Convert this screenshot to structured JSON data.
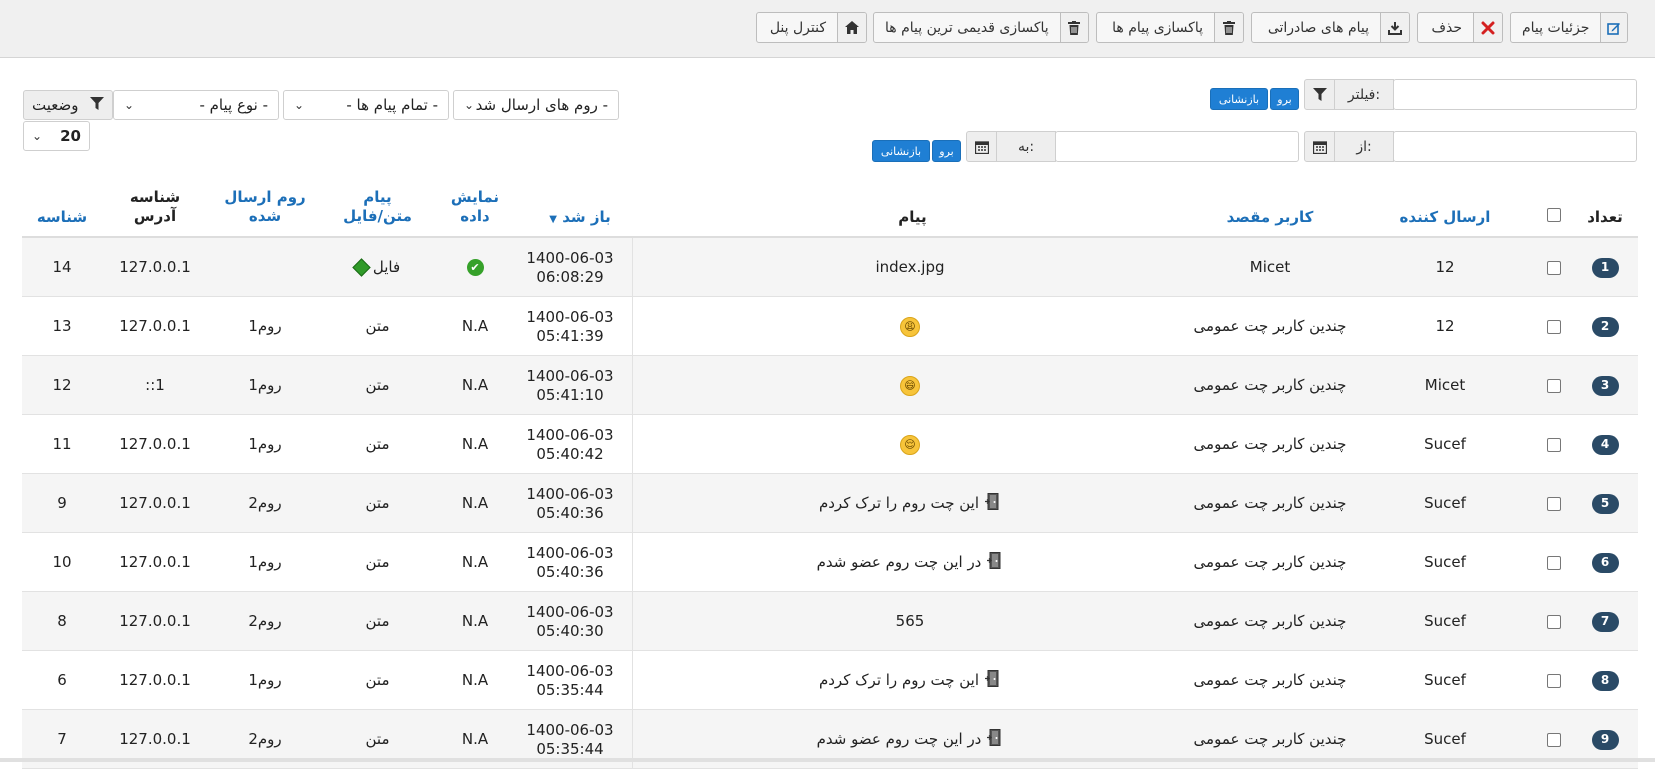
{
  "toolbar": {
    "details": "جزئیات پیام",
    "delete": "حذف",
    "export": "پیام های صادراتی",
    "purge": "پاکسازی پیام ها",
    "purge_oldest": "پاکسازی قدیمی ترین پیام ها",
    "control_panel": "کنترل پنل"
  },
  "filters": {
    "filter_label": "فیلتر:",
    "go": "برو",
    "reset": "بازنشانی",
    "from_label": "از:",
    "to_label": "به:",
    "go2": "برو",
    "reset2": "بازنشانی",
    "rooms_select": "- روم های ارسال شد",
    "messages_select": "- تمام پیام ها -",
    "type_select": "- نوع پیام -",
    "status_label": "وضعیت",
    "page_size": "20"
  },
  "table": {
    "headers": {
      "count": "تعداد",
      "sender": "ارسال کننده",
      "target": "کاربر مقصد",
      "message": "پیام",
      "seen": "باز شد",
      "shown_l1": "نمایش",
      "shown_l2": "داده",
      "msg_type_l1": "پیام",
      "msg_type_l2": "متن/فایل",
      "room_l1": "روم ارسال",
      "room_l2": "شده",
      "addr_l1": "شناسه",
      "addr_l2": "آدرس",
      "id": "شناسه"
    },
    "rows": [
      {
        "n": "1",
        "sender": "12",
        "target": "Micet",
        "message": "index.jpg",
        "icon": "none",
        "date": "1400-06-03",
        "time": "06:08:29",
        "shown": "",
        "shown_icon": "check-icon",
        "type": "فایل",
        "type_icon": "file-icon",
        "room": "",
        "ip": "127.0.0.1",
        "id": "14"
      },
      {
        "n": "2",
        "sender": "12",
        "target": "چندین کاربر چت عمومی",
        "message": "",
        "icon": "tired-emoji",
        "emoji": "😩",
        "date": "1400-06-03",
        "time": "05:41:39",
        "shown": "N.A",
        "type": "متن",
        "room": "روم1",
        "ip": "127.0.0.1",
        "id": "13"
      },
      {
        "n": "3",
        "sender": "Micet",
        "target": "چندین کاربر چت عمومی",
        "message": "",
        "icon": "grin-emoji",
        "emoji": "😄",
        "date": "1400-06-03",
        "time": "05:41:10",
        "shown": "N.A",
        "type": "متن",
        "room": "روم1",
        "ip": "::1",
        "id": "12"
      },
      {
        "n": "4",
        "sender": "Sucef",
        "target": "چندین کاربر چت عمومی",
        "message": "",
        "icon": "relieved-emoji",
        "emoji": "😌",
        "date": "1400-06-03",
        "time": "05:40:42",
        "shown": "N.A",
        "type": "متن",
        "room": "روم1",
        "ip": "127.0.0.1",
        "id": "11"
      },
      {
        "n": "5",
        "sender": "Sucef",
        "target": "چندین کاربر چت عمومی",
        "message": "این چت روم را ترک کردم",
        "icon": "door-icon",
        "date": "1400-06-03",
        "time": "05:40:36",
        "shown": "N.A",
        "type": "متن",
        "room": "روم2",
        "ip": "127.0.0.1",
        "id": "9"
      },
      {
        "n": "6",
        "sender": "Sucef",
        "target": "چندین کاربر چت عمومی",
        "message": "در این چت روم عضو شدم",
        "icon": "door-icon",
        "date": "1400-06-03",
        "time": "05:40:36",
        "shown": "N.A",
        "type": "متن",
        "room": "روم1",
        "ip": "127.0.0.1",
        "id": "10"
      },
      {
        "n": "7",
        "sender": "Sucef",
        "target": "چندین کاربر چت عمومی",
        "message": "565",
        "icon": "none",
        "date": "1400-06-03",
        "time": "05:40:30",
        "shown": "N.A",
        "type": "متن",
        "room": "روم2",
        "ip": "127.0.0.1",
        "id": "8"
      },
      {
        "n": "8",
        "sender": "Sucef",
        "target": "چندین کاربر چت عمومی",
        "message": "این چت روم را ترک کردم",
        "icon": "door-icon",
        "date": "1400-06-03",
        "time": "05:35:44",
        "shown": "N.A",
        "type": "متن",
        "room": "روم1",
        "ip": "127.0.0.1",
        "id": "6"
      },
      {
        "n": "9",
        "sender": "Sucef",
        "target": "چندین کاربر چت عمومی",
        "message": "در این چت روم عضو شدم",
        "icon": "door-icon",
        "date": "1400-06-03",
        "time": "05:35:44",
        "shown": "N.A",
        "type": "متن",
        "room": "روم2",
        "ip": "127.0.0.1",
        "id": "7"
      }
    ]
  },
  "colors": {
    "link": "#1c6fb8",
    "badge": "#2a4a66",
    "button_blue": "#1f7fd4",
    "delete_red": "#d42020"
  }
}
